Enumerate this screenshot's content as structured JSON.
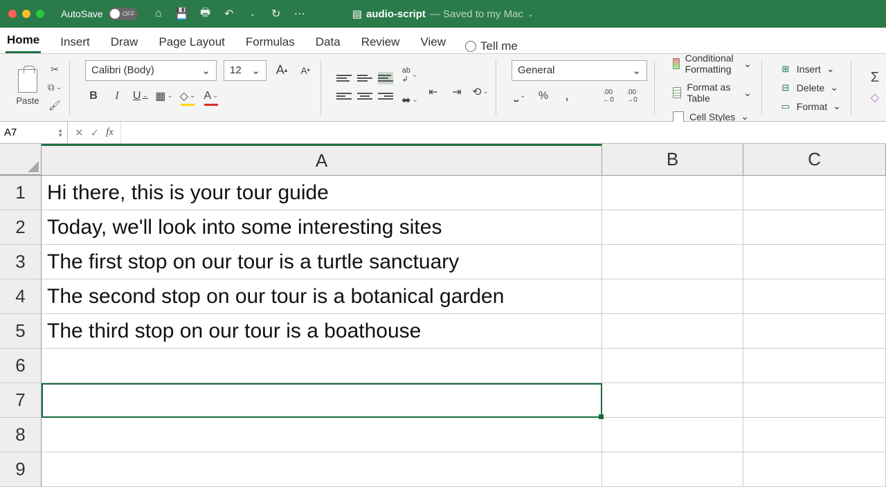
{
  "titlebar": {
    "autosave_label": "AutoSave",
    "autosave_state": "OFF",
    "filename": "audio-script",
    "status": "— Saved to my Mac"
  },
  "tabs": [
    "Home",
    "Insert",
    "Draw",
    "Page Layout",
    "Formulas",
    "Data",
    "Review",
    "View"
  ],
  "tellme": "Tell me",
  "ribbon": {
    "paste": "Paste",
    "font_name": "Calibri (Body)",
    "font_size": "12",
    "number_format": "General",
    "cond_fmt": "Conditional Formatting",
    "fmt_table": "Format as Table",
    "cell_styles": "Cell Styles",
    "insert": "Insert",
    "delete": "Delete",
    "format": "Format"
  },
  "namebox": "A7",
  "formula": "",
  "columns": [
    "A",
    "B",
    "C"
  ],
  "rows": [
    {
      "n": "1",
      "a": "Hi there, this is your tour guide"
    },
    {
      "n": "2",
      "a": "Today, we'll look into some interesting sites"
    },
    {
      "n": "3",
      "a": "The first stop on our tour is a turtle sanctuary"
    },
    {
      "n": "4",
      "a": "The second stop on our tour is a botanical garden"
    },
    {
      "n": "5",
      "a": "The third stop on our tour is a boathouse"
    },
    {
      "n": "6",
      "a": ""
    },
    {
      "n": "7",
      "a": ""
    },
    {
      "n": "8",
      "a": ""
    },
    {
      "n": "9",
      "a": ""
    }
  ],
  "selected_cell": "A7"
}
